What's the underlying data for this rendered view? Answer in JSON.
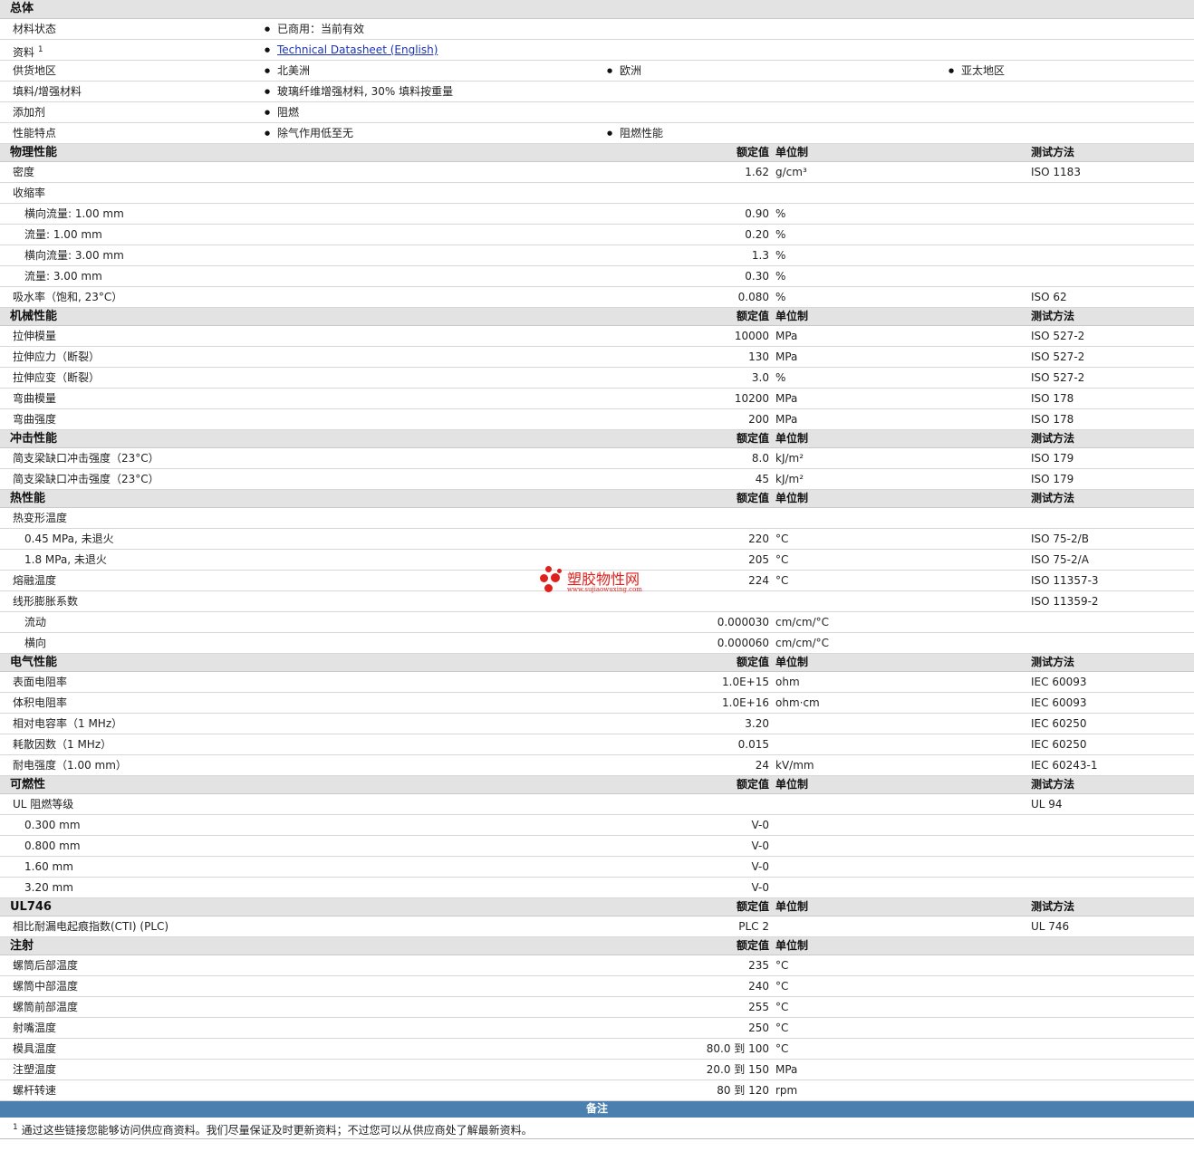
{
  "general": {
    "title": "总体",
    "rows": [
      {
        "label": "材料状态",
        "bullets": [
          "已商用：当前有效"
        ]
      },
      {
        "label": "资料",
        "sup": "1",
        "bullets": [
          "Technical Datasheet (English)"
        ],
        "link": true
      },
      {
        "label": "供货地区",
        "bullets": [
          "北美洲",
          "欧洲",
          "亚太地区"
        ]
      },
      {
        "label": "填料/增强材料",
        "bullets": [
          "玻璃纤维增强材料, 30% 填料按重量"
        ]
      },
      {
        "label": "添加剂",
        "bullets": [
          "阻燃"
        ]
      },
      {
        "label": "性能特点",
        "bullets": [
          "除气作用低至无",
          "阻燃性能"
        ]
      }
    ]
  },
  "col_headers": {
    "value": "额定值",
    "unit": "单位制",
    "test": "测试方法"
  },
  "sections": [
    {
      "title": "物理性能",
      "show_test": true,
      "rows": [
        {
          "label": "密度",
          "value": "1.62",
          "unit": "g/cm³",
          "test": "ISO 1183"
        },
        {
          "label": "收缩率"
        },
        {
          "label": "横向流量: 1.00 mm",
          "sub": true,
          "value": "0.90",
          "unit": "%"
        },
        {
          "label": "流量: 1.00 mm",
          "sub": true,
          "value": "0.20",
          "unit": "%"
        },
        {
          "label": "横向流量: 3.00 mm",
          "sub": true,
          "value": "1.3",
          "unit": "%"
        },
        {
          "label": "流量: 3.00 mm",
          "sub": true,
          "value": "0.30",
          "unit": "%"
        },
        {
          "label": "吸水率（饱和, 23°C）",
          "value": "0.080",
          "unit": "%",
          "test": "ISO 62"
        }
      ]
    },
    {
      "title": "机械性能",
      "show_test": true,
      "rows": [
        {
          "label": "拉伸模量",
          "value": "10000",
          "unit": "MPa",
          "test": "ISO 527-2"
        },
        {
          "label": "拉伸应力（断裂）",
          "value": "130",
          "unit": "MPa",
          "test": "ISO 527-2"
        },
        {
          "label": "拉伸应变（断裂）",
          "value": "3.0",
          "unit": "%",
          "test": "ISO 527-2"
        },
        {
          "label": "弯曲模量",
          "value": "10200",
          "unit": "MPa",
          "test": "ISO 178"
        },
        {
          "label": "弯曲强度",
          "value": "200",
          "unit": "MPa",
          "test": "ISO 178"
        }
      ]
    },
    {
      "title": "冲击性能",
      "show_test": true,
      "rows": [
        {
          "label": "简支梁缺口冲击强度（23°C）",
          "value": "8.0",
          "unit": "kJ/m²",
          "test": "ISO 179"
        },
        {
          "label": "简支梁缺口冲击强度（23°C）",
          "value": "45",
          "unit": "kJ/m²",
          "test": "ISO 179"
        }
      ]
    },
    {
      "title": "热性能",
      "show_test": true,
      "rows": [
        {
          "label": "热变形温度"
        },
        {
          "label": "0.45 MPa, 未退火",
          "sub": true,
          "value": "220",
          "unit": "°C",
          "test": "ISO 75-2/B"
        },
        {
          "label": "1.8 MPa, 未退火",
          "sub": true,
          "value": "205",
          "unit": "°C",
          "test": "ISO 75-2/A"
        },
        {
          "label": "熔融温度",
          "value": "224",
          "unit": "°C",
          "test": "ISO 11357-3"
        },
        {
          "label": "线形膨胀系数",
          "test": "ISO 11359-2"
        },
        {
          "label": "流动",
          "sub": true,
          "value": "0.000030",
          "unit": "cm/cm/°C"
        },
        {
          "label": "横向",
          "sub": true,
          "value": "0.000060",
          "unit": "cm/cm/°C"
        }
      ]
    },
    {
      "title": "电气性能",
      "show_test": true,
      "rows": [
        {
          "label": "表面电阻率",
          "value": "1.0E+15",
          "unit": "ohm",
          "test": "IEC 60093"
        },
        {
          "label": "体积电阻率",
          "value": "1.0E+16",
          "unit": "ohm·cm",
          "test": "IEC 60093"
        },
        {
          "label": "相对电容率（1 MHz）",
          "value": "3.20",
          "test": "IEC 60250"
        },
        {
          "label": "耗散因数（1 MHz）",
          "value": "0.015",
          "test": "IEC 60250"
        },
        {
          "label": "耐电强度（1.00 mm）",
          "value": "24",
          "unit": "kV/mm",
          "test": "IEC 60243-1"
        }
      ]
    },
    {
      "title": "可燃性",
      "show_test": true,
      "rows": [
        {
          "label": "UL 阻燃等级",
          "test": "UL 94"
        },
        {
          "label": "0.300 mm",
          "sub": true,
          "value": "V-0"
        },
        {
          "label": "0.800 mm",
          "sub": true,
          "value": "V-0"
        },
        {
          "label": "1.60 mm",
          "sub": true,
          "value": "V-0"
        },
        {
          "label": "3.20 mm",
          "sub": true,
          "value": "V-0"
        }
      ]
    },
    {
      "title": "UL746",
      "show_test": true,
      "rows": [
        {
          "label": "相比耐漏电起痕指数(CTI) (PLC)",
          "value": "PLC 2",
          "test": "UL 746"
        }
      ]
    },
    {
      "title": "注射",
      "show_test": false,
      "rows": [
        {
          "label": "螺筒后部温度",
          "value": "235",
          "unit": "°C"
        },
        {
          "label": "螺筒中部温度",
          "value": "240",
          "unit": "°C"
        },
        {
          "label": "螺筒前部温度",
          "value": "255",
          "unit": "°C"
        },
        {
          "label": "射嘴温度",
          "value": "250",
          "unit": "°C"
        },
        {
          "label": "模具温度",
          "value": "80.0 到  100",
          "unit": "°C"
        },
        {
          "label": "注塑温度",
          "value": "20.0 到  150",
          "unit": "MPa"
        },
        {
          "label": "螺杆转速",
          "value": "80 到  120",
          "unit": "rpm"
        }
      ]
    }
  ],
  "notes": {
    "title": "备注",
    "sup": "1",
    "text": "通过这些链接您能够访问供应商资料。我们尽量保证及时更新资料；不过您可以从供应商处了解最新资料。"
  },
  "logo": {
    "name": "塑胶物性网",
    "url": "www.sujiaowuxing.com"
  },
  "colors": {
    "header_bg": "#e3e3e3",
    "notes_bar": "#4a7fb0",
    "link": "#1a33b5",
    "logo_red": "#e0201c"
  }
}
